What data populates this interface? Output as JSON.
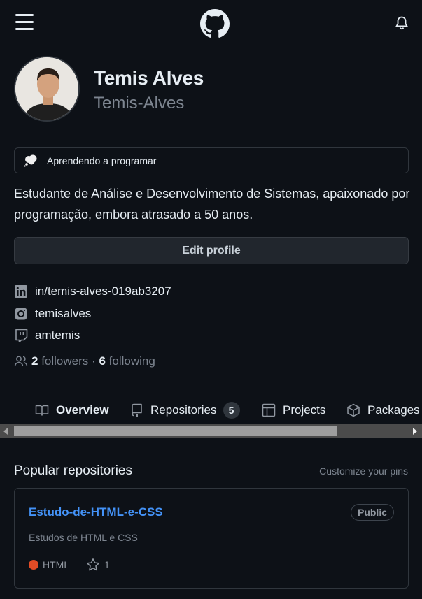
{
  "header": {
    "menu_icon": "hamburger-icon",
    "logo_icon": "github-octocat-icon",
    "notifications_icon": "bell-icon"
  },
  "profile": {
    "full_name": "Temis Alves",
    "username": "Temis-Alves",
    "status_icon": "thought-balloon-icon",
    "status_text": "Aprendendo a programar",
    "bio": "Estudante de Análise e Desenvolvimento de Sistemas, apaixonado por programação, embora atrasado a 50 anos.",
    "edit_button": "Edit profile",
    "social": [
      {
        "icon": "linkedin-icon",
        "label": "in/temis-alves-019ab3207"
      },
      {
        "icon": "instagram-icon",
        "label": "temisalves"
      },
      {
        "icon": "twitch-icon",
        "label": "amtemis"
      }
    ],
    "followers_count": "2",
    "followers_label": "followers",
    "separator": "·",
    "following_count": "6",
    "following_label": "following"
  },
  "tabs": [
    {
      "label": "Overview",
      "icon": "book-icon",
      "active": true
    },
    {
      "label": "Repositories",
      "icon": "repo-icon",
      "counter": "5"
    },
    {
      "label": "Projects",
      "icon": "table-icon"
    },
    {
      "label": "Packages",
      "icon": "package-icon"
    }
  ],
  "popular": {
    "title": "Popular repositories",
    "customize_link": "Customize your pins",
    "repos": [
      {
        "name": "Estudo-de-HTML-e-CSS",
        "visibility": "Public",
        "description": "Estudos de HTML e CSS",
        "language": "HTML",
        "language_color": "#e34c26",
        "stars": "1"
      }
    ]
  },
  "colors": {
    "background": "#0d1117",
    "link": "#4493f8",
    "muted": "#7d8590"
  }
}
